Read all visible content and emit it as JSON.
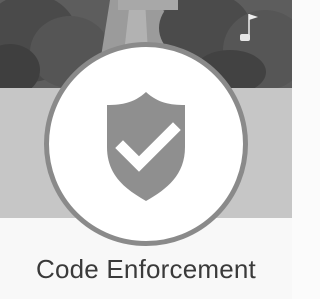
{
  "card": {
    "title": "Code Enforcement",
    "icon": "shield-check-icon",
    "background_image": "street-photo",
    "colors": {
      "shield": "#8f8f8f",
      "check": "#ffffff",
      "ring": "#8a8a8a",
      "band": "#c6c6c6",
      "title": "#3a3a3a"
    }
  }
}
